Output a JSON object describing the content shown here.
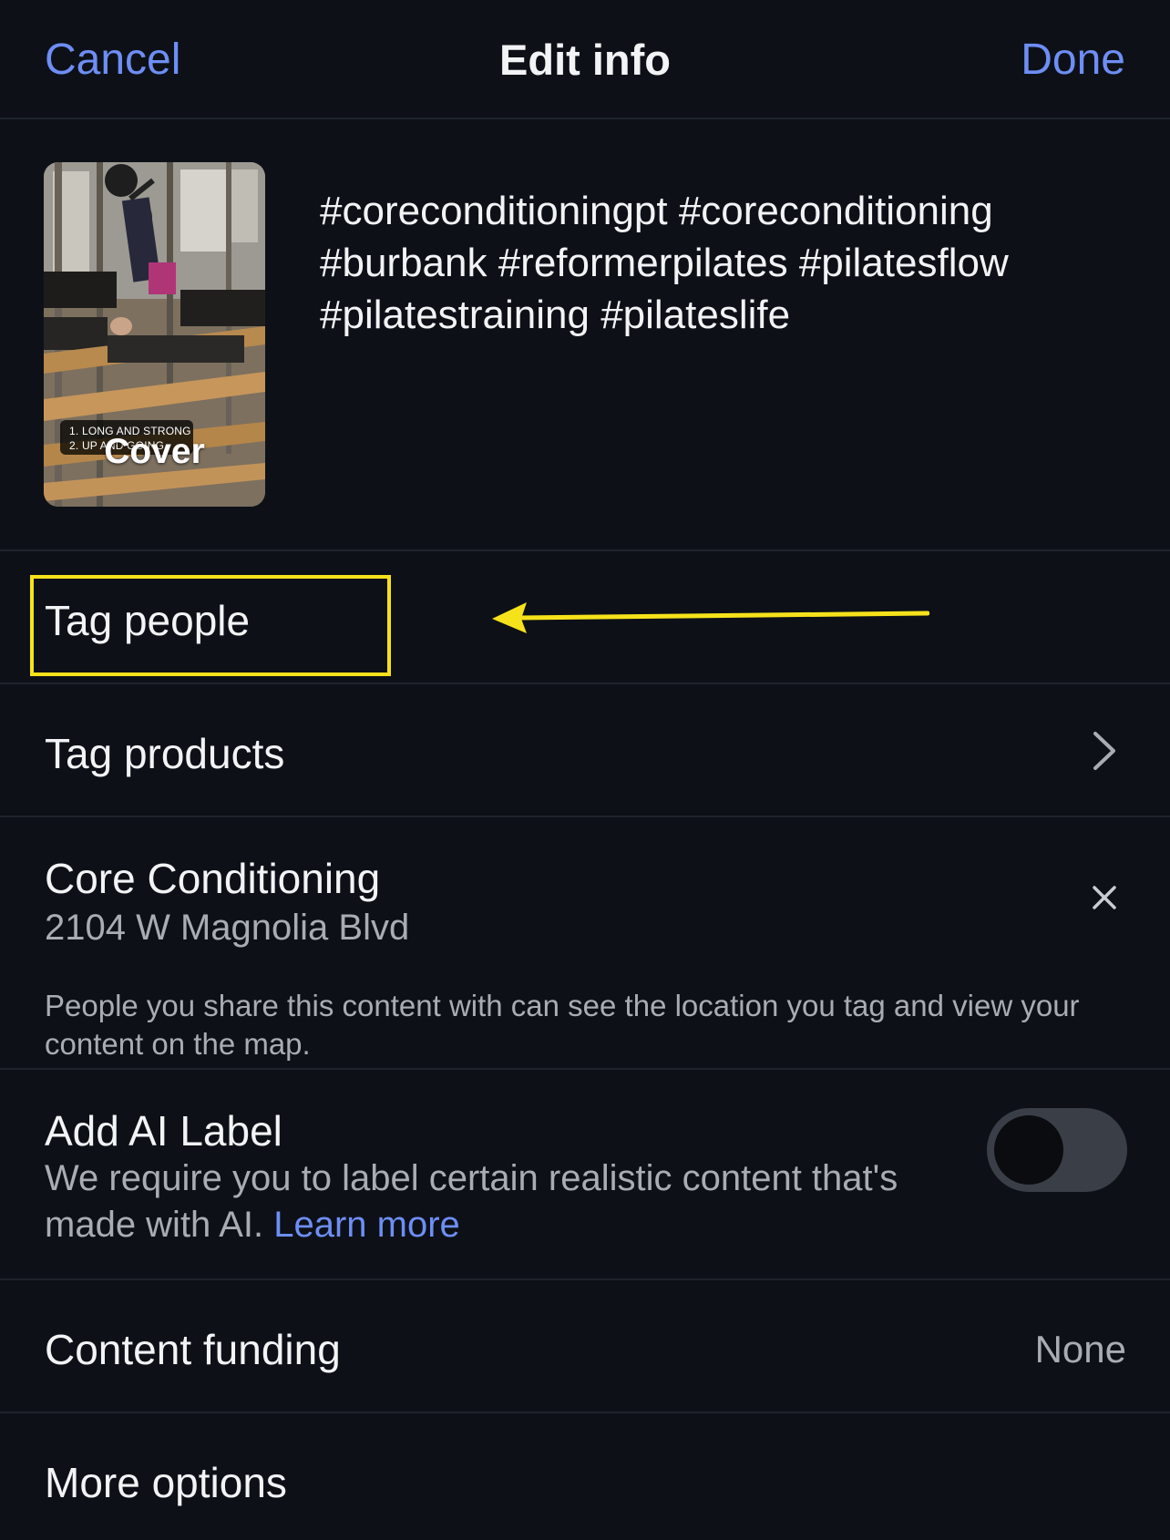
{
  "header": {
    "cancel_label": "Cancel",
    "title": "Edit info",
    "done_label": "Done"
  },
  "media": {
    "cover_label": "Cover",
    "overlay_lines": [
      "1. LONG AND STRONG",
      "2. UP AND GOING"
    ],
    "caption": "#coreconditioningpt #coreconditioning #burbank #reformerpilates #pilatesflow #pilatestraining #pilateslife"
  },
  "rows": {
    "tag_people": "Tag people",
    "tag_products": "Tag products",
    "location": {
      "name": "Core Conditioning",
      "address": "2104 W Magnolia Blvd",
      "note": "People you share this content with can see the location you tag and view your content on the map."
    },
    "ai_label": {
      "title": "Add AI Label",
      "description": "We require you to label certain realistic content that's made with AI.",
      "learn_more": "Learn more",
      "enabled": false
    },
    "content_funding": {
      "label": "Content funding",
      "value": "None"
    },
    "more_options": "More options"
  },
  "icons": {
    "chevron": "chevron-right-icon",
    "close": "close-icon",
    "annotation_arrow": "arrow-left-icon"
  },
  "colors": {
    "background": "#0d1117",
    "accent": "#6e8ef5",
    "highlight": "#f6e21a",
    "secondary_text": "#a9adb3"
  }
}
